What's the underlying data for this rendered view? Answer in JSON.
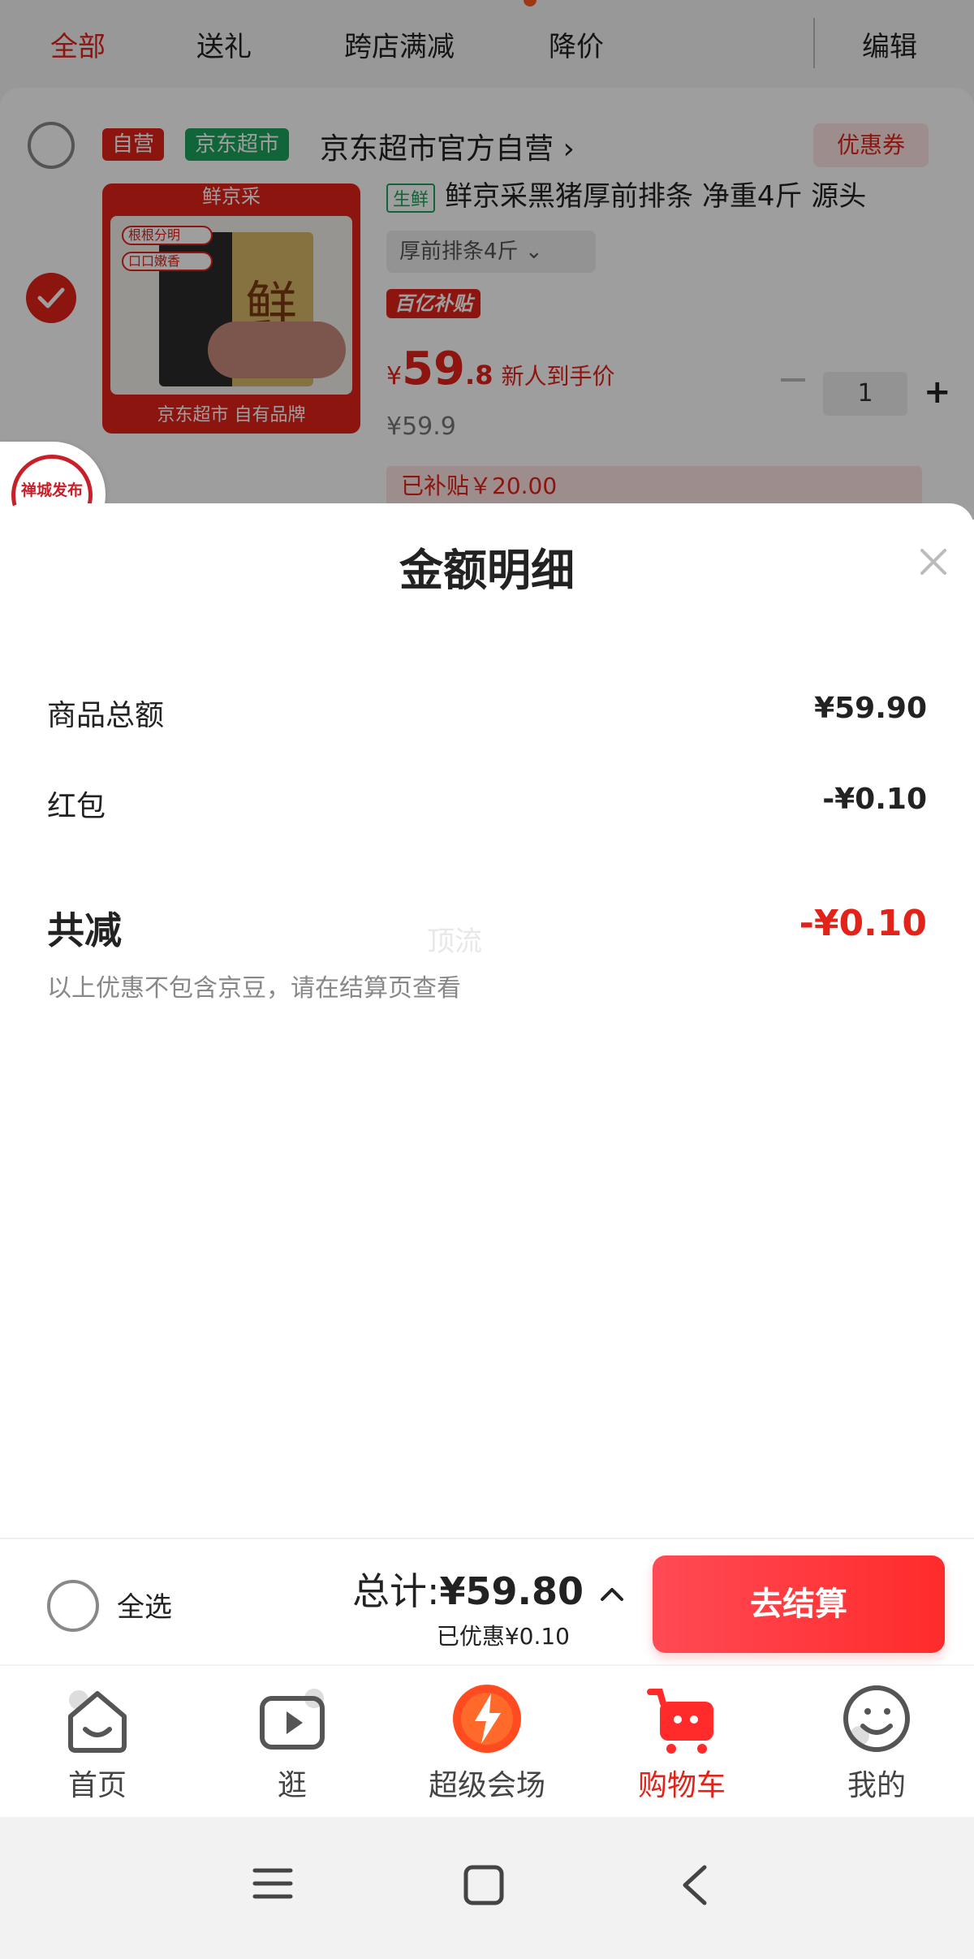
{
  "top_tabs": [
    {
      "label": "全部",
      "active": true
    },
    {
      "label": "送礼",
      "active": false
    },
    {
      "label": "跨店满减",
      "active": false
    },
    {
      "label": "降价",
      "active": false
    }
  ],
  "edit_label": "编辑",
  "shop": {
    "tag_self": "自营",
    "tag_super": "京东超市",
    "name": "京东超市官方自营 ›",
    "coupon": "优惠券"
  },
  "product": {
    "image_top": "鲜京采",
    "image_char": "鲜",
    "image_bubble_1": "根根分明",
    "image_bubble_2": "口口嫩香",
    "image_bottom": "京东超市 自有品牌",
    "fresh_tag": "生鲜",
    "title": "鲜京采黑猪厚前排条 净重4斤 源头",
    "spec": "厚前排条4斤",
    "spec_arrow": "⌄",
    "subsidy_badge": "百亿补贴",
    "price_yen": "¥",
    "price_int": "59",
    "price_dec": ".8",
    "price_note": "新人到手价",
    "original_price": "¥59.9",
    "quantity": "1",
    "plus": "+",
    "subsidized": "已补贴￥20.00"
  },
  "seal_text": "禅城发布",
  "sheet": {
    "title": "金额明细",
    "rows": [
      {
        "label": "商品总额",
        "value": "¥59.90"
      },
      {
        "label": "红包",
        "value": "-¥0.10"
      }
    ],
    "total_label": "共减",
    "total_value": "-¥0.10",
    "note": "以上优惠不包含京豆，请在结算页查看",
    "watermark": "顶流"
  },
  "checkout": {
    "select_all": "全选",
    "total_prefix": "总计:",
    "total_value": "¥59.80",
    "saved": "已优惠¥0.10",
    "button": "去结算"
  },
  "tabbar": [
    {
      "label": "首页",
      "icon": "home-icon",
      "active": false
    },
    {
      "label": "逛",
      "icon": "video-play-icon",
      "active": false
    },
    {
      "label": "超级会场",
      "icon": "super-venue-icon",
      "active": false
    },
    {
      "label": "购物车",
      "icon": "cart-icon",
      "active": true
    },
    {
      "label": "我的",
      "icon": "profile-smile-icon",
      "active": false
    }
  ],
  "colors": {
    "accent": "#e2231a",
    "checkout_button": "#ff3b3b",
    "green_tag": "#1aa35c"
  }
}
